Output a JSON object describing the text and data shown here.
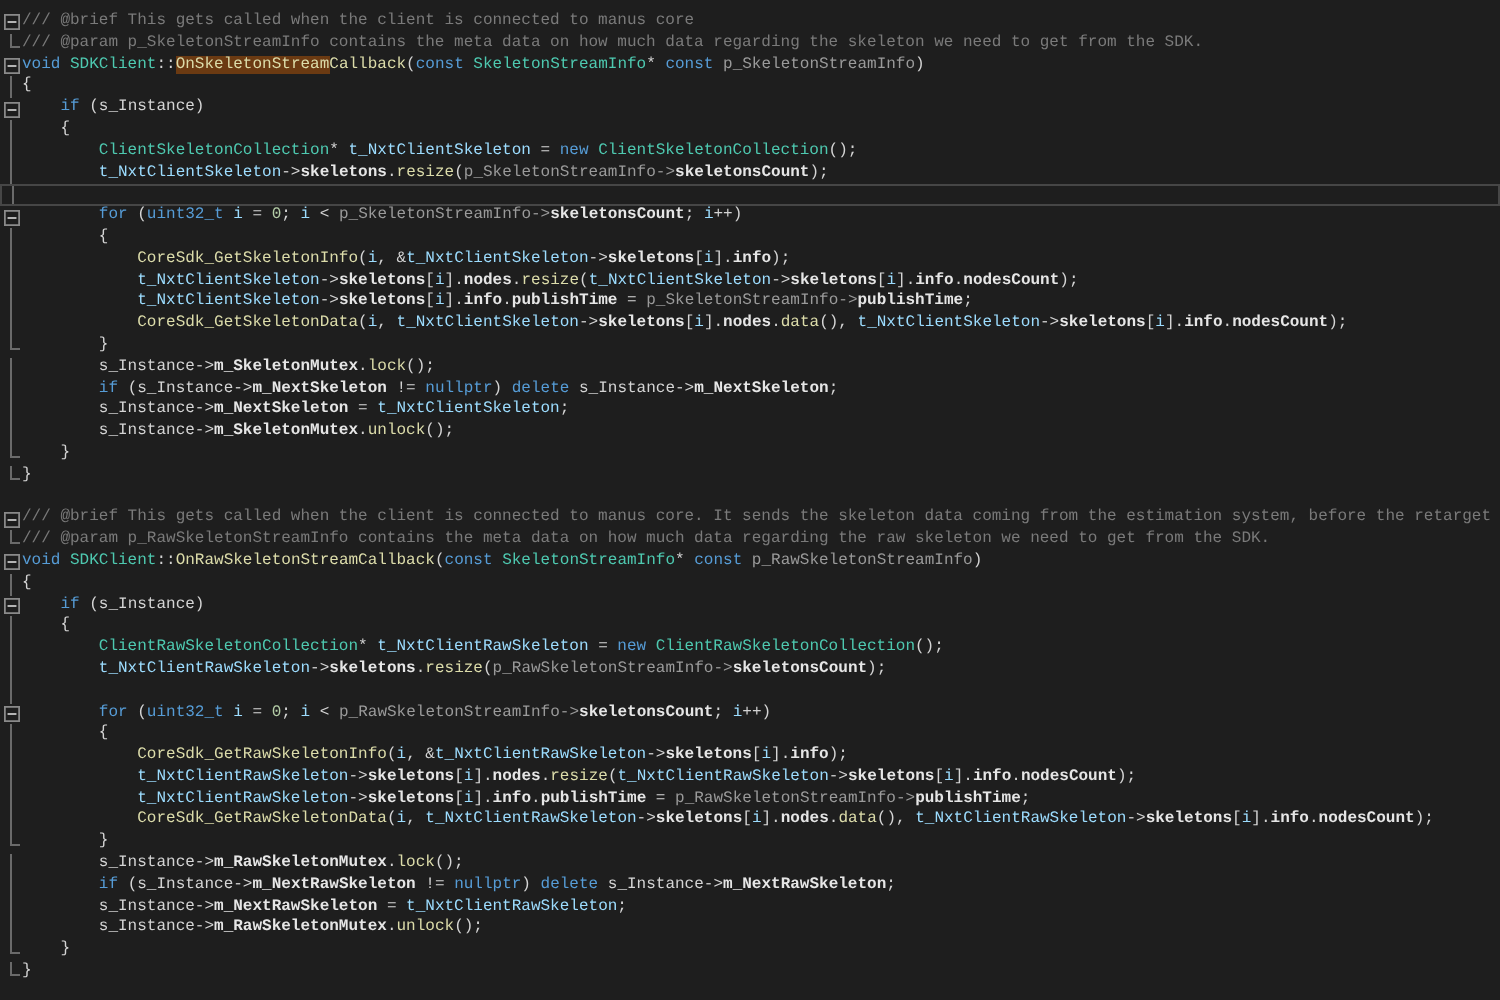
{
  "editor": {
    "lines": [
      {
        "kind": "fold",
        "current": false,
        "tokens": [
          {
            "kind": "comment",
            "text": "/// @brief This gets called when the client is connected to manus core"
          }
        ]
      },
      {
        "kind": "end",
        "current": false,
        "tokens": [
          {
            "kind": "comment",
            "text": "/// @param p_SkeletonStreamInfo contains the meta data on how much data regarding the skeleton we need to get from the SDK."
          }
        ]
      },
      {
        "kind": "fold",
        "current": false,
        "tokens": [
          {
            "kind": "keyword",
            "text": "void"
          },
          {
            "kind": "type",
            "text": " SDKClient"
          },
          {
            "kind": "plain",
            "text": "::"
          },
          {
            "kind": "match",
            "text": "OnSkeletonStream"
          },
          {
            "kind": "function",
            "text": "Callback"
          },
          {
            "kind": "plain",
            "text": "("
          },
          {
            "kind": "keyword",
            "text": "const"
          },
          {
            "kind": "type",
            "text": " SkeletonStreamInfo"
          },
          {
            "kind": "plain",
            "text": "* "
          },
          {
            "kind": "keyword",
            "text": "const"
          },
          {
            "kind": "param",
            "text": " p_SkeletonStreamInfo"
          },
          {
            "kind": "plain",
            "text": ")"
          }
        ]
      },
      {
        "kind": "guide",
        "current": false,
        "tokens": [
          {
            "kind": "plain",
            "text": "{"
          }
        ]
      },
      {
        "kind": "fold",
        "current": false,
        "tokens": [
          {
            "kind": "keyword",
            "text": "    if"
          },
          {
            "kind": "plain",
            "text": " (s_Instance)"
          }
        ]
      },
      {
        "kind": "guide",
        "current": false,
        "tokens": [
          {
            "kind": "plain",
            "text": "    {"
          }
        ]
      },
      {
        "kind": "guide",
        "current": false,
        "tokens": [
          {
            "kind": "type",
            "text": "        ClientSkeletonCollection"
          },
          {
            "kind": "plain",
            "text": "* "
          },
          {
            "kind": "local",
            "text": "t_NxtClientSkeleton"
          },
          {
            "kind": "plain",
            "text": " = "
          },
          {
            "kind": "keyword",
            "text": "new"
          },
          {
            "kind": "type",
            "text": " ClientSkeletonCollection"
          },
          {
            "kind": "plain",
            "text": "();"
          }
        ]
      },
      {
        "kind": "guide",
        "current": false,
        "tokens": [
          {
            "kind": "local",
            "text": "        t_NxtClientSkeleton"
          },
          {
            "kind": "plain",
            "text": "->"
          },
          {
            "kind": "member",
            "text": "skeletons"
          },
          {
            "kind": "plain",
            "text": "."
          },
          {
            "kind": "function",
            "text": "resize"
          },
          {
            "kind": "plain",
            "text": "("
          },
          {
            "kind": "param",
            "text": "p_SkeletonStreamInfo->"
          },
          {
            "kind": "member",
            "text": "skeletonsCount"
          },
          {
            "kind": "plain",
            "text": ");"
          }
        ]
      },
      {
        "kind": "guide",
        "current": true
      },
      {
        "kind": "fold",
        "current": false,
        "tokens": [
          {
            "kind": "keyword",
            "text": "        for"
          },
          {
            "kind": "plain",
            "text": " ("
          },
          {
            "kind": "keyword",
            "text": "uint32_t"
          },
          {
            "kind": "local",
            "text": " i"
          },
          {
            "kind": "plain",
            "text": " = "
          },
          {
            "kind": "number",
            "text": "0"
          },
          {
            "kind": "plain",
            "text": "; "
          },
          {
            "kind": "local",
            "text": "i"
          },
          {
            "kind": "plain",
            "text": " < "
          },
          {
            "kind": "param",
            "text": "p_SkeletonStreamInfo->"
          },
          {
            "kind": "member",
            "text": "skeletonsCount"
          },
          {
            "kind": "plain",
            "text": "; "
          },
          {
            "kind": "local",
            "text": "i"
          },
          {
            "kind": "plain",
            "text": "++)"
          }
        ]
      },
      {
        "kind": "guide",
        "current": false,
        "tokens": [
          {
            "kind": "plain",
            "text": "        {"
          }
        ]
      },
      {
        "kind": "guide",
        "current": false,
        "tokens": [
          {
            "kind": "function",
            "text": "            CoreSdk_GetSkeletonInfo"
          },
          {
            "kind": "plain",
            "text": "("
          },
          {
            "kind": "local",
            "text": "i"
          },
          {
            "kind": "plain",
            "text": ", &"
          },
          {
            "kind": "local",
            "text": "t_NxtClientSkeleton"
          },
          {
            "kind": "plain",
            "text": "->"
          },
          {
            "kind": "member",
            "text": "skeletons"
          },
          {
            "kind": "plain",
            "text": "["
          },
          {
            "kind": "local",
            "text": "i"
          },
          {
            "kind": "plain",
            "text": "]."
          },
          {
            "kind": "member",
            "text": "info"
          },
          {
            "kind": "plain",
            "text": ");"
          }
        ]
      },
      {
        "kind": "guide",
        "current": false,
        "tokens": [
          {
            "kind": "local",
            "text": "            t_NxtClientSkeleton"
          },
          {
            "kind": "plain",
            "text": "->"
          },
          {
            "kind": "member",
            "text": "skeletons"
          },
          {
            "kind": "plain",
            "text": "["
          },
          {
            "kind": "local",
            "text": "i"
          },
          {
            "kind": "plain",
            "text": "]."
          },
          {
            "kind": "member",
            "text": "nodes"
          },
          {
            "kind": "plain",
            "text": "."
          },
          {
            "kind": "function",
            "text": "resize"
          },
          {
            "kind": "plain",
            "text": "("
          },
          {
            "kind": "local",
            "text": "t_NxtClientSkeleton"
          },
          {
            "kind": "plain",
            "text": "->"
          },
          {
            "kind": "member",
            "text": "skeletons"
          },
          {
            "kind": "plain",
            "text": "["
          },
          {
            "kind": "local",
            "text": "i"
          },
          {
            "kind": "plain",
            "text": "]."
          },
          {
            "kind": "member",
            "text": "info"
          },
          {
            "kind": "plain",
            "text": "."
          },
          {
            "kind": "member",
            "text": "nodesCount"
          },
          {
            "kind": "plain",
            "text": ");"
          }
        ]
      },
      {
        "kind": "guide",
        "current": false,
        "tokens": [
          {
            "kind": "local",
            "text": "            t_NxtClientSkeleton"
          },
          {
            "kind": "plain",
            "text": "->"
          },
          {
            "kind": "member",
            "text": "skeletons"
          },
          {
            "kind": "plain",
            "text": "["
          },
          {
            "kind": "local",
            "text": "i"
          },
          {
            "kind": "plain",
            "text": "]."
          },
          {
            "kind": "member",
            "text": "info"
          },
          {
            "kind": "plain",
            "text": "."
          },
          {
            "kind": "member",
            "text": "publishTime"
          },
          {
            "kind": "plain",
            "text": " = "
          },
          {
            "kind": "param",
            "text": "p_SkeletonStreamInfo->"
          },
          {
            "kind": "member",
            "text": "publishTime"
          },
          {
            "kind": "plain",
            "text": ";"
          }
        ]
      },
      {
        "kind": "guide",
        "current": false,
        "tokens": [
          {
            "kind": "function",
            "text": "            CoreSdk_GetSkeletonData"
          },
          {
            "kind": "plain",
            "text": "("
          },
          {
            "kind": "local",
            "text": "i"
          },
          {
            "kind": "plain",
            "text": ", "
          },
          {
            "kind": "local",
            "text": "t_NxtClientSkeleton"
          },
          {
            "kind": "plain",
            "text": "->"
          },
          {
            "kind": "member",
            "text": "skeletons"
          },
          {
            "kind": "plain",
            "text": "["
          },
          {
            "kind": "local",
            "text": "i"
          },
          {
            "kind": "plain",
            "text": "]."
          },
          {
            "kind": "member",
            "text": "nodes"
          },
          {
            "kind": "plain",
            "text": "."
          },
          {
            "kind": "function",
            "text": "data"
          },
          {
            "kind": "plain",
            "text": "(), "
          },
          {
            "kind": "local",
            "text": "t_NxtClientSkeleton"
          },
          {
            "kind": "plain",
            "text": "->"
          },
          {
            "kind": "member",
            "text": "skeletons"
          },
          {
            "kind": "plain",
            "text": "["
          },
          {
            "kind": "local",
            "text": "i"
          },
          {
            "kind": "plain",
            "text": "]."
          },
          {
            "kind": "member",
            "text": "info"
          },
          {
            "kind": "plain",
            "text": "."
          },
          {
            "kind": "member",
            "text": "nodesCount"
          },
          {
            "kind": "plain",
            "text": ");"
          }
        ]
      },
      {
        "kind": "end",
        "current": false,
        "tokens": [
          {
            "kind": "plain",
            "text": "        }"
          }
        ]
      },
      {
        "kind": "guide",
        "current": false,
        "tokens": [
          {
            "kind": "plain",
            "text": "        s_Instance->"
          },
          {
            "kind": "member",
            "text": "m_SkeletonMutex"
          },
          {
            "kind": "plain",
            "text": "."
          },
          {
            "kind": "function",
            "text": "lock"
          },
          {
            "kind": "plain",
            "text": "();"
          }
        ]
      },
      {
        "kind": "guide",
        "current": false,
        "tokens": [
          {
            "kind": "keyword",
            "text": "        if"
          },
          {
            "kind": "plain",
            "text": " (s_Instance->"
          },
          {
            "kind": "member",
            "text": "m_NextSkeleton"
          },
          {
            "kind": "plain",
            "text": " != "
          },
          {
            "kind": "keyword",
            "text": "nullptr"
          },
          {
            "kind": "plain",
            "text": ") "
          },
          {
            "kind": "keyword",
            "text": "delete"
          },
          {
            "kind": "plain",
            "text": " s_Instance->"
          },
          {
            "kind": "member",
            "text": "m_NextSkeleton"
          },
          {
            "kind": "plain",
            "text": ";"
          }
        ]
      },
      {
        "kind": "guide",
        "current": false,
        "tokens": [
          {
            "kind": "plain",
            "text": "        s_Instance->"
          },
          {
            "kind": "member",
            "text": "m_NextSkeleton"
          },
          {
            "kind": "plain",
            "text": " = "
          },
          {
            "kind": "local",
            "text": "t_NxtClientSkeleton"
          },
          {
            "kind": "plain",
            "text": ";"
          }
        ]
      },
      {
        "kind": "guide",
        "current": false,
        "tokens": [
          {
            "kind": "plain",
            "text": "        s_Instance->"
          },
          {
            "kind": "member",
            "text": "m_SkeletonMutex"
          },
          {
            "kind": "plain",
            "text": "."
          },
          {
            "kind": "function",
            "text": "unlock"
          },
          {
            "kind": "plain",
            "text": "();"
          }
        ]
      },
      {
        "kind": "end",
        "current": false,
        "tokens": [
          {
            "kind": "plain",
            "text": "    }"
          }
        ]
      },
      {
        "kind": "end",
        "current": false,
        "tokens": [
          {
            "kind": "plain",
            "text": "}"
          }
        ]
      },
      {
        "kind": "blank",
        "current": false
      },
      {
        "kind": "fold",
        "current": false,
        "tokens": [
          {
            "kind": "comment",
            "text": "/// @brief This gets called when the client is connected to manus core. It sends the skeleton data coming from the estimation system, before the retarget"
          }
        ]
      },
      {
        "kind": "end",
        "current": false,
        "tokens": [
          {
            "kind": "comment",
            "text": "/// @param p_RawSkeletonStreamInfo contains the meta data on how much data regarding the raw skeleton we need to get from the SDK."
          }
        ]
      },
      {
        "kind": "fold",
        "current": false,
        "tokens": [
          {
            "kind": "keyword",
            "text": "void"
          },
          {
            "kind": "type",
            "text": " SDKClient"
          },
          {
            "kind": "plain",
            "text": "::"
          },
          {
            "kind": "function",
            "text": "OnRawSkeletonStreamCallback"
          },
          {
            "kind": "plain",
            "text": "("
          },
          {
            "kind": "keyword",
            "text": "const"
          },
          {
            "kind": "type",
            "text": " SkeletonStreamInfo"
          },
          {
            "kind": "plain",
            "text": "* "
          },
          {
            "kind": "keyword",
            "text": "const"
          },
          {
            "kind": "param",
            "text": " p_RawSkeletonStreamInfo"
          },
          {
            "kind": "plain",
            "text": ")"
          }
        ]
      },
      {
        "kind": "guide",
        "current": false,
        "tokens": [
          {
            "kind": "plain",
            "text": "{"
          }
        ]
      },
      {
        "kind": "fold",
        "current": false,
        "tokens": [
          {
            "kind": "keyword",
            "text": "    if"
          },
          {
            "kind": "plain",
            "text": " (s_Instance)"
          }
        ]
      },
      {
        "kind": "guide",
        "current": false,
        "tokens": [
          {
            "kind": "plain",
            "text": "    {"
          }
        ]
      },
      {
        "kind": "guide",
        "current": false,
        "tokens": [
          {
            "kind": "type",
            "text": "        ClientRawSkeletonCollection"
          },
          {
            "kind": "plain",
            "text": "* "
          },
          {
            "kind": "local",
            "text": "t_NxtClientRawSkeleton"
          },
          {
            "kind": "plain",
            "text": " = "
          },
          {
            "kind": "keyword",
            "text": "new"
          },
          {
            "kind": "type",
            "text": " ClientRawSkeletonCollection"
          },
          {
            "kind": "plain",
            "text": "();"
          }
        ]
      },
      {
        "kind": "guide",
        "current": false,
        "tokens": [
          {
            "kind": "local",
            "text": "        t_NxtClientRawSkeleton"
          },
          {
            "kind": "plain",
            "text": "->"
          },
          {
            "kind": "member",
            "text": "skeletons"
          },
          {
            "kind": "plain",
            "text": "."
          },
          {
            "kind": "function",
            "text": "resize"
          },
          {
            "kind": "plain",
            "text": "("
          },
          {
            "kind": "param",
            "text": "p_RawSkeletonStreamInfo->"
          },
          {
            "kind": "member",
            "text": "skeletonsCount"
          },
          {
            "kind": "plain",
            "text": ");"
          }
        ]
      },
      {
        "kind": "guide",
        "current": false
      },
      {
        "kind": "fold",
        "current": false,
        "tokens": [
          {
            "kind": "keyword",
            "text": "        for"
          },
          {
            "kind": "plain",
            "text": " ("
          },
          {
            "kind": "keyword",
            "text": "uint32_t"
          },
          {
            "kind": "local",
            "text": " i"
          },
          {
            "kind": "plain",
            "text": " = "
          },
          {
            "kind": "number",
            "text": "0"
          },
          {
            "kind": "plain",
            "text": "; "
          },
          {
            "kind": "local",
            "text": "i"
          },
          {
            "kind": "plain",
            "text": " < "
          },
          {
            "kind": "param",
            "text": "p_RawSkeletonStreamInfo->"
          },
          {
            "kind": "member",
            "text": "skeletonsCount"
          },
          {
            "kind": "plain",
            "text": "; "
          },
          {
            "kind": "local",
            "text": "i"
          },
          {
            "kind": "plain",
            "text": "++)"
          }
        ]
      },
      {
        "kind": "guide",
        "current": false,
        "tokens": [
          {
            "kind": "plain",
            "text": "        {"
          }
        ]
      },
      {
        "kind": "guide",
        "current": false,
        "tokens": [
          {
            "kind": "function",
            "text": "            CoreSdk_GetRawSkeletonInfo"
          },
          {
            "kind": "plain",
            "text": "("
          },
          {
            "kind": "local",
            "text": "i"
          },
          {
            "kind": "plain",
            "text": ", &"
          },
          {
            "kind": "local",
            "text": "t_NxtClientRawSkeleton"
          },
          {
            "kind": "plain",
            "text": "->"
          },
          {
            "kind": "member",
            "text": "skeletons"
          },
          {
            "kind": "plain",
            "text": "["
          },
          {
            "kind": "local",
            "text": "i"
          },
          {
            "kind": "plain",
            "text": "]."
          },
          {
            "kind": "member",
            "text": "info"
          },
          {
            "kind": "plain",
            "text": ");"
          }
        ]
      },
      {
        "kind": "guide",
        "current": false,
        "tokens": [
          {
            "kind": "local",
            "text": "            t_NxtClientRawSkeleton"
          },
          {
            "kind": "plain",
            "text": "->"
          },
          {
            "kind": "member",
            "text": "skeletons"
          },
          {
            "kind": "plain",
            "text": "["
          },
          {
            "kind": "local",
            "text": "i"
          },
          {
            "kind": "plain",
            "text": "]."
          },
          {
            "kind": "member",
            "text": "nodes"
          },
          {
            "kind": "plain",
            "text": "."
          },
          {
            "kind": "function",
            "text": "resize"
          },
          {
            "kind": "plain",
            "text": "("
          },
          {
            "kind": "local",
            "text": "t_NxtClientRawSkeleton"
          },
          {
            "kind": "plain",
            "text": "->"
          },
          {
            "kind": "member",
            "text": "skeletons"
          },
          {
            "kind": "plain",
            "text": "["
          },
          {
            "kind": "local",
            "text": "i"
          },
          {
            "kind": "plain",
            "text": "]."
          },
          {
            "kind": "member",
            "text": "info"
          },
          {
            "kind": "plain",
            "text": "."
          },
          {
            "kind": "member",
            "text": "nodesCount"
          },
          {
            "kind": "plain",
            "text": ");"
          }
        ]
      },
      {
        "kind": "guide",
        "current": false,
        "tokens": [
          {
            "kind": "local",
            "text": "            t_NxtClientRawSkeleton"
          },
          {
            "kind": "plain",
            "text": "->"
          },
          {
            "kind": "member",
            "text": "skeletons"
          },
          {
            "kind": "plain",
            "text": "["
          },
          {
            "kind": "local",
            "text": "i"
          },
          {
            "kind": "plain",
            "text": "]."
          },
          {
            "kind": "member",
            "text": "info"
          },
          {
            "kind": "plain",
            "text": "."
          },
          {
            "kind": "member",
            "text": "publishTime"
          },
          {
            "kind": "plain",
            "text": " = "
          },
          {
            "kind": "param",
            "text": "p_RawSkeletonStreamInfo->"
          },
          {
            "kind": "member",
            "text": "publishTime"
          },
          {
            "kind": "plain",
            "text": ";"
          }
        ]
      },
      {
        "kind": "guide",
        "current": false,
        "tokens": [
          {
            "kind": "function",
            "text": "            CoreSdk_GetRawSkeletonData"
          },
          {
            "kind": "plain",
            "text": "("
          },
          {
            "kind": "local",
            "text": "i"
          },
          {
            "kind": "plain",
            "text": ", "
          },
          {
            "kind": "local",
            "text": "t_NxtClientRawSkeleton"
          },
          {
            "kind": "plain",
            "text": "->"
          },
          {
            "kind": "member",
            "text": "skeletons"
          },
          {
            "kind": "plain",
            "text": "["
          },
          {
            "kind": "local",
            "text": "i"
          },
          {
            "kind": "plain",
            "text": "]."
          },
          {
            "kind": "member",
            "text": "nodes"
          },
          {
            "kind": "plain",
            "text": "."
          },
          {
            "kind": "function",
            "text": "data"
          },
          {
            "kind": "plain",
            "text": "(), "
          },
          {
            "kind": "local",
            "text": "t_NxtClientRawSkeleton"
          },
          {
            "kind": "plain",
            "text": "->"
          },
          {
            "kind": "member",
            "text": "skeletons"
          },
          {
            "kind": "plain",
            "text": "["
          },
          {
            "kind": "local",
            "text": "i"
          },
          {
            "kind": "plain",
            "text": "]."
          },
          {
            "kind": "member",
            "text": "info"
          },
          {
            "kind": "plain",
            "text": "."
          },
          {
            "kind": "member",
            "text": "nodesCount"
          },
          {
            "kind": "plain",
            "text": ");"
          }
        ]
      },
      {
        "kind": "end",
        "current": false,
        "tokens": [
          {
            "kind": "plain",
            "text": "        }"
          }
        ]
      },
      {
        "kind": "guide",
        "current": false,
        "tokens": [
          {
            "kind": "plain",
            "text": "        s_Instance->"
          },
          {
            "kind": "member",
            "text": "m_RawSkeletonMutex"
          },
          {
            "kind": "plain",
            "text": "."
          },
          {
            "kind": "function",
            "text": "lock"
          },
          {
            "kind": "plain",
            "text": "();"
          }
        ]
      },
      {
        "kind": "guide",
        "current": false,
        "tokens": [
          {
            "kind": "keyword",
            "text": "        if"
          },
          {
            "kind": "plain",
            "text": " (s_Instance->"
          },
          {
            "kind": "member",
            "text": "m_NextRawSkeleton"
          },
          {
            "kind": "plain",
            "text": " != "
          },
          {
            "kind": "keyword",
            "text": "nullptr"
          },
          {
            "kind": "plain",
            "text": ") "
          },
          {
            "kind": "keyword",
            "text": "delete"
          },
          {
            "kind": "plain",
            "text": " s_Instance->"
          },
          {
            "kind": "member",
            "text": "m_NextRawSkeleton"
          },
          {
            "kind": "plain",
            "text": ";"
          }
        ]
      },
      {
        "kind": "guide",
        "current": false,
        "tokens": [
          {
            "kind": "plain",
            "text": "        s_Instance->"
          },
          {
            "kind": "member",
            "text": "m_NextRawSkeleton"
          },
          {
            "kind": "plain",
            "text": " = "
          },
          {
            "kind": "local",
            "text": "t_NxtClientRawSkeleton"
          },
          {
            "kind": "plain",
            "text": ";"
          }
        ]
      },
      {
        "kind": "guide",
        "current": false,
        "tokens": [
          {
            "kind": "plain",
            "text": "        s_Instance->"
          },
          {
            "kind": "member",
            "text": "m_RawSkeletonMutex"
          },
          {
            "kind": "plain",
            "text": "."
          },
          {
            "kind": "function",
            "text": "unlock"
          },
          {
            "kind": "plain",
            "text": "();"
          }
        ]
      },
      {
        "kind": "end",
        "current": false,
        "tokens": [
          {
            "kind": "plain",
            "text": "    }"
          }
        ]
      },
      {
        "kind": "end",
        "current": false,
        "tokens": [
          {
            "kind": "plain",
            "text": "}"
          }
        ]
      }
    ]
  }
}
